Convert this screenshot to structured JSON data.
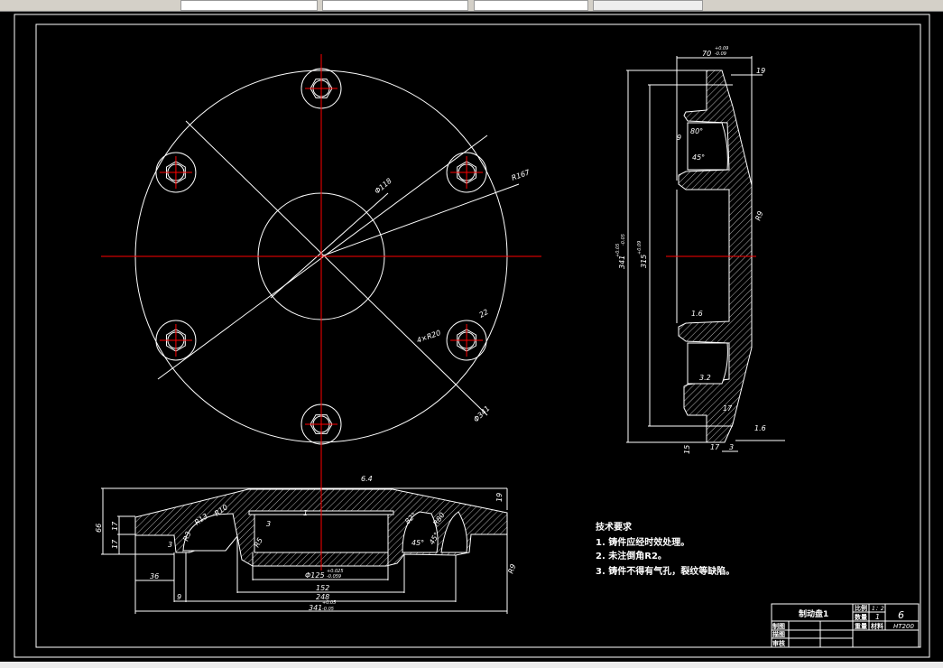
{
  "colors": {
    "background": "#000000",
    "lines": "#ffffff",
    "centerline": "#ff0000",
    "toolbar": "#d4d0c8"
  },
  "top_view": {
    "dims": {
      "d_inner": "Φ118",
      "r_outer": "R167",
      "bolt_r": "4×R20",
      "hole": "22",
      "d_bolt": "Φ341"
    }
  },
  "side_view": {
    "dims": {
      "width": "70",
      "width_tol_up": "+0.09",
      "width_tol_dn": "-0.09",
      "top_step": "19",
      "rib": "9",
      "angle1": "80°",
      "angle2": "45°",
      "r9": "R9",
      "dia_outer": "341",
      "dia_outer_tol_up": "+0.05",
      "dia_outer_tol_dn": "-0.05",
      "dia_inner": "315",
      "dia_inner_tol": "+0.09",
      "rough1": "1.6",
      "rough2": "3.2",
      "rough3": "1.6",
      "w17a": "17",
      "w17b": "17",
      "w3": "3",
      "w15": "15"
    }
  },
  "section_view": {
    "dims": {
      "rough": "6.4",
      "h19": "19",
      "h66": "66",
      "h17a": "17",
      "h17b": "17",
      "r13": "R13",
      "r10": "R10",
      "r3": "R3",
      "r5": "R5",
      "d3a": "3",
      "d3b": "3",
      "d1": "1",
      "r2": "R2",
      "r80": "R80",
      "a1": "82°",
      "a2": "45°",
      "a3": "45°",
      "w36": "36",
      "w9": "9",
      "d125": "Φ125",
      "d125_up": "+0.025",
      "d125_dn": "-0.059",
      "w152": "152",
      "w248": "248",
      "w341": "341",
      "w341_up": "+0.05",
      "w341_dn": "-0.05",
      "r9": "R9"
    }
  },
  "requirements": {
    "title": "技术要求",
    "items": [
      "1. 铸件应经时效处理。",
      "2. 未注倒角R2。",
      "3. 铸件不得有气孔，裂纹等缺陷。"
    ]
  },
  "title_block": {
    "part_name": "制动盘1",
    "scale_label": "比例",
    "scale": "1：2",
    "qty_label": "数量",
    "qty": "1",
    "weight_label": "重量",
    "material_label": "材料",
    "material": "HT200",
    "drawing_no": "6",
    "drawn_label": "制图",
    "traced_label": "描图",
    "checked_label": "审核"
  }
}
